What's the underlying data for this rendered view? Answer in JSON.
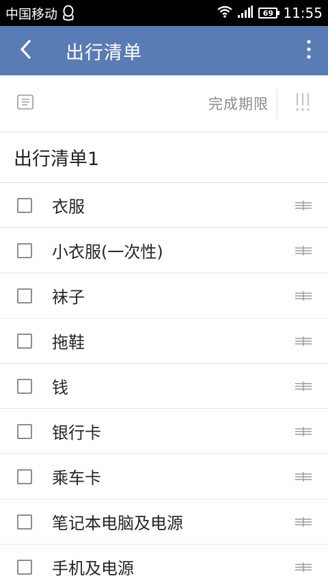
{
  "status_bar": {
    "carrier": "中国移动",
    "battery": "69",
    "time": "11:55",
    "icons": [
      "qq-icon",
      "wifi-icon",
      "signal-icon",
      "battery-icon"
    ]
  },
  "app_bar": {
    "title": "出行清单",
    "back_icon": "chevron-left-icon",
    "more_icon": "more-vertical-icon"
  },
  "toolbar": {
    "note_icon": "note-icon",
    "deadline_label": "完成期限",
    "priority_icon": "priority-icon"
  },
  "list": {
    "title": "出行清单1",
    "items": [
      {
        "label": "衣服",
        "checked": false
      },
      {
        "label": "小衣服(一次性)",
        "checked": false
      },
      {
        "label": "袜子",
        "checked": false
      },
      {
        "label": "拖鞋",
        "checked": false
      },
      {
        "label": "钱",
        "checked": false
      },
      {
        "label": "银行卡",
        "checked": false
      },
      {
        "label": "乘车卡",
        "checked": false
      },
      {
        "label": "笔记本电脑及电源",
        "checked": false
      },
      {
        "label": "手机及电源",
        "checked": false
      }
    ]
  },
  "colors": {
    "app_bar": "#5a7cb5",
    "status_bar": "#000000",
    "divider": "#e6e6e6",
    "muted_text": "#8a8a8a"
  }
}
